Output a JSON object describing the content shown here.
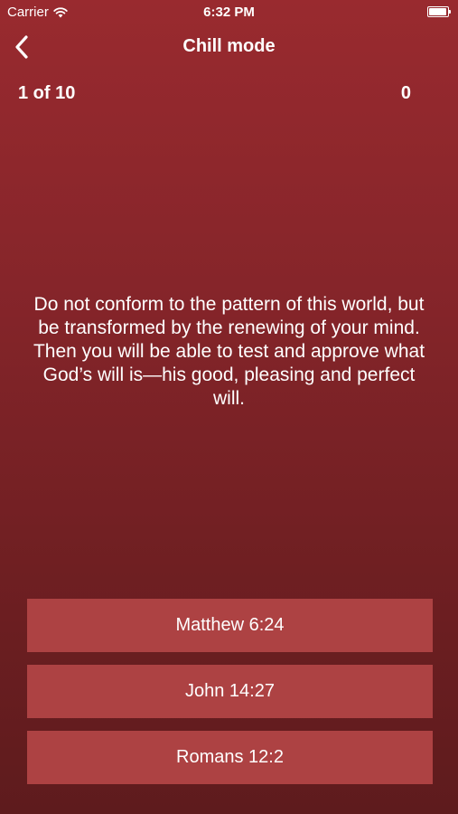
{
  "status_bar": {
    "carrier": "Carrier",
    "time": "6:32 PM",
    "icons": [
      "wifi-icon",
      "battery-icon"
    ]
  },
  "nav": {
    "title": "Chill mode",
    "back_icon": "chevron-left-icon"
  },
  "quiz": {
    "progress": "1 of 10",
    "score": "0",
    "verse": "Do not conform to the pattern of this world, but be transformed by the renewing of your mind. Then you will be able to test and approve what God’s will is—his good, pleasing and perfect will.",
    "answers": [
      {
        "label": "Matthew 6:24"
      },
      {
        "label": "John 14:27"
      },
      {
        "label": "Romans 12:2"
      }
    ]
  },
  "colors": {
    "background_top": "#992a2f",
    "background_bottom": "#5e1b1d",
    "answer_button": "#ad4243",
    "text": "#ffffff"
  }
}
